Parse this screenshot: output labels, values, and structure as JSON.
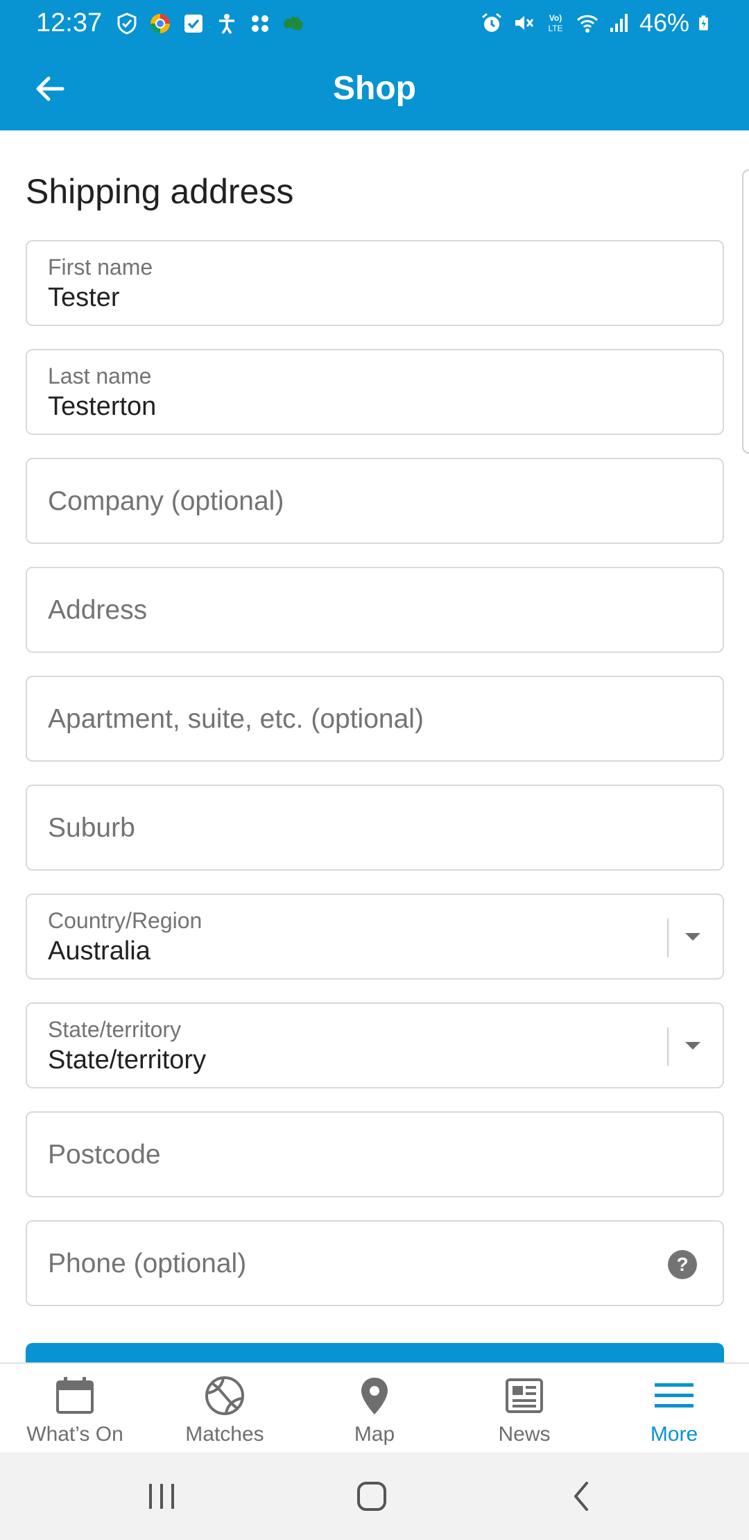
{
  "status_bar": {
    "time": "12:37",
    "battery": "46%",
    "left_icons": [
      "shield-icon",
      "browser-icon",
      "checkbox-icon",
      "accessibility-icon",
      "apps-icon",
      "australia-map-icon"
    ],
    "right_icons": [
      "alarm-icon",
      "mute-icon",
      "volte-icon",
      "wifi-icon",
      "signal-icon",
      "battery-icon"
    ]
  },
  "header": {
    "title": "Shop",
    "back_icon": "arrow-left-icon"
  },
  "form": {
    "section_title": "Shipping address",
    "first_name": {
      "label": "First name",
      "value": "Tester"
    },
    "last_name": {
      "label": "Last name",
      "value": "Testerton"
    },
    "company": {
      "placeholder": "Company (optional)"
    },
    "address": {
      "placeholder": "Address"
    },
    "apartment": {
      "placeholder": "Apartment, suite, etc. (optional)"
    },
    "suburb": {
      "placeholder": "Suburb"
    },
    "country": {
      "label": "Country/Region",
      "value": "Australia"
    },
    "state": {
      "label": "State/territory",
      "value": "State/territory"
    },
    "postcode": {
      "placeholder": "Postcode"
    },
    "phone": {
      "placeholder": "Phone (optional)",
      "help_icon": "question-circle-icon"
    }
  },
  "tabs": [
    {
      "label": "What’s On",
      "icon": "calendar-icon",
      "active": false
    },
    {
      "label": "Matches",
      "icon": "ball-icon",
      "active": false
    },
    {
      "label": "Map",
      "icon": "map-pin-icon",
      "active": false
    },
    {
      "label": "News",
      "icon": "newspaper-icon",
      "active": false
    },
    {
      "label": "More",
      "icon": "menu-icon",
      "active": true
    }
  ],
  "colors": {
    "brand": "#0893d2",
    "field_border": "#d9d9d9",
    "label_grey": "#737373",
    "tab_inactive": "#6e6e6e"
  }
}
